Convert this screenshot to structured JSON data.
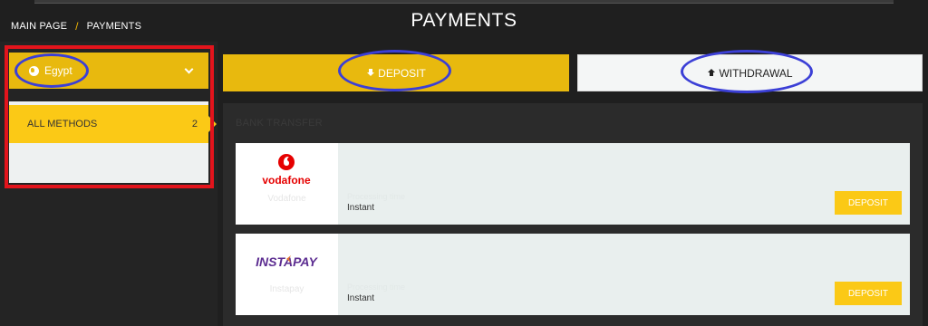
{
  "breadcrumb": {
    "home": "MAIN PAGE",
    "separator": "/",
    "current": "PAYMENTS"
  },
  "page": {
    "title": "PAYMENTS"
  },
  "sidebar": {
    "country": "Egypt",
    "methods": [
      {
        "label": "ALL METHODS",
        "count": "2"
      }
    ]
  },
  "tabs": {
    "deposit": "DEPOSIT",
    "withdrawal": "WITHDRAWAL"
  },
  "section": {
    "heading": "BANK TRANSFER"
  },
  "cards": [
    {
      "logo_text": "vodafone",
      "name": "Vodafone",
      "subtle": "Processing time",
      "speed": "Instant",
      "button": "DEPOSIT"
    },
    {
      "logo_text": "INSTAPAY",
      "name": "Instapay",
      "subtle": "Processing time",
      "speed": "Instant",
      "button": "DEPOSIT"
    }
  ],
  "colors": {
    "accent": "#e8b90e",
    "highlight_red": "#e3141c",
    "annotation_blue": "#3b3fd6",
    "vodafone_red": "#e60000",
    "instapay_purple": "#5c2d91"
  }
}
